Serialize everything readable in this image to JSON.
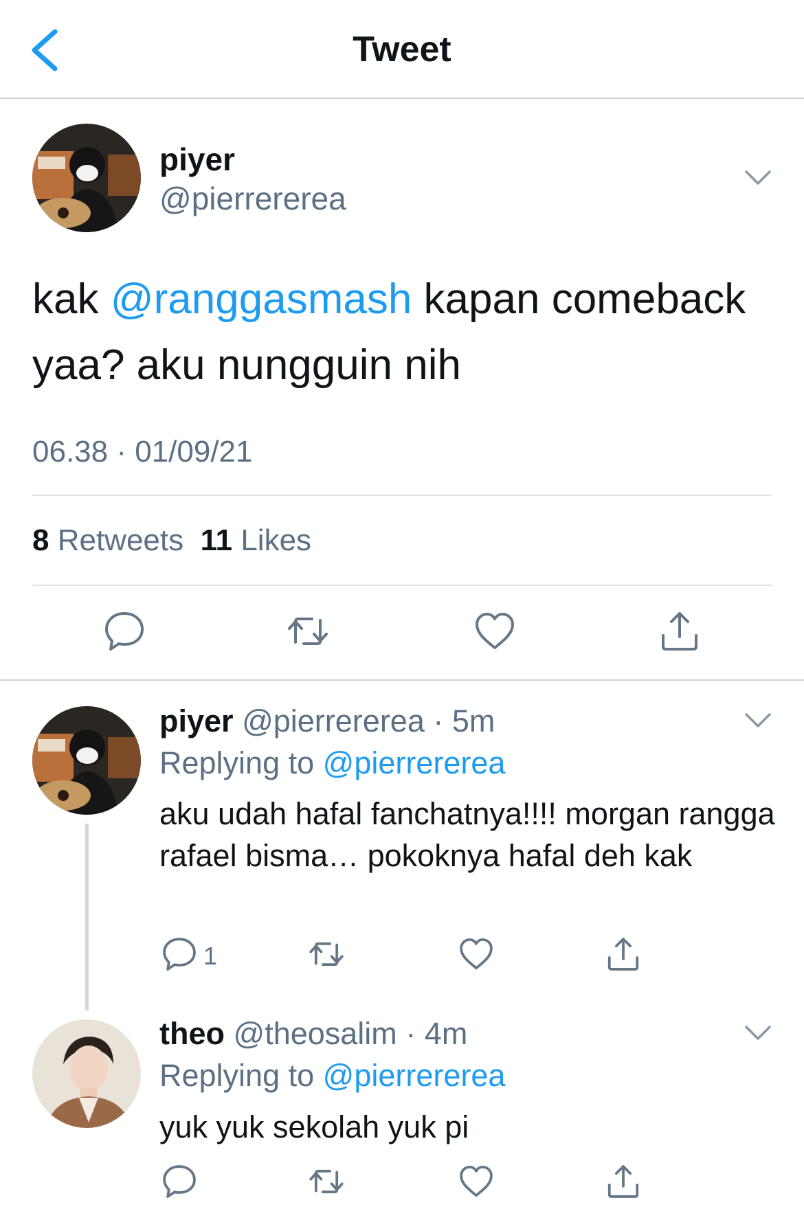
{
  "header": {
    "title": "Tweet",
    "back_icon": "chevron-left-icon"
  },
  "accent": "#1d9bf0",
  "main_tweet": {
    "name": "piyer",
    "handle": "@pierrererea",
    "text_prefix": "kak ",
    "mention": "@ranggasmash",
    "text_suffix": " kapan comeback yaa? aku nungguin nih",
    "timestamp": "06.38 · 01/09/21",
    "retweets_count": "8",
    "retweets_label": " Retweets",
    "likes_count": "11",
    "likes_label": " Likes",
    "actions": [
      "reply-icon",
      "retweet-icon",
      "like-icon",
      "share-icon"
    ]
  },
  "replies": [
    {
      "name": "piyer",
      "handle": "@pierrererea",
      "time": "· 5m",
      "replying_label": "Replying to ",
      "replying_to": "@pierrererea",
      "text": "aku udah hafal fanchatnya!!!! morgan rangga rafael bisma… pokoknya hafal deh kak",
      "reply_count": "1"
    },
    {
      "name": "theo",
      "handle": "@theosalim",
      "time": "· 4m",
      "replying_label": "Replying to ",
      "replying_to": "@pierrererea",
      "text": "yuk yuk sekolah yuk pi"
    }
  ]
}
